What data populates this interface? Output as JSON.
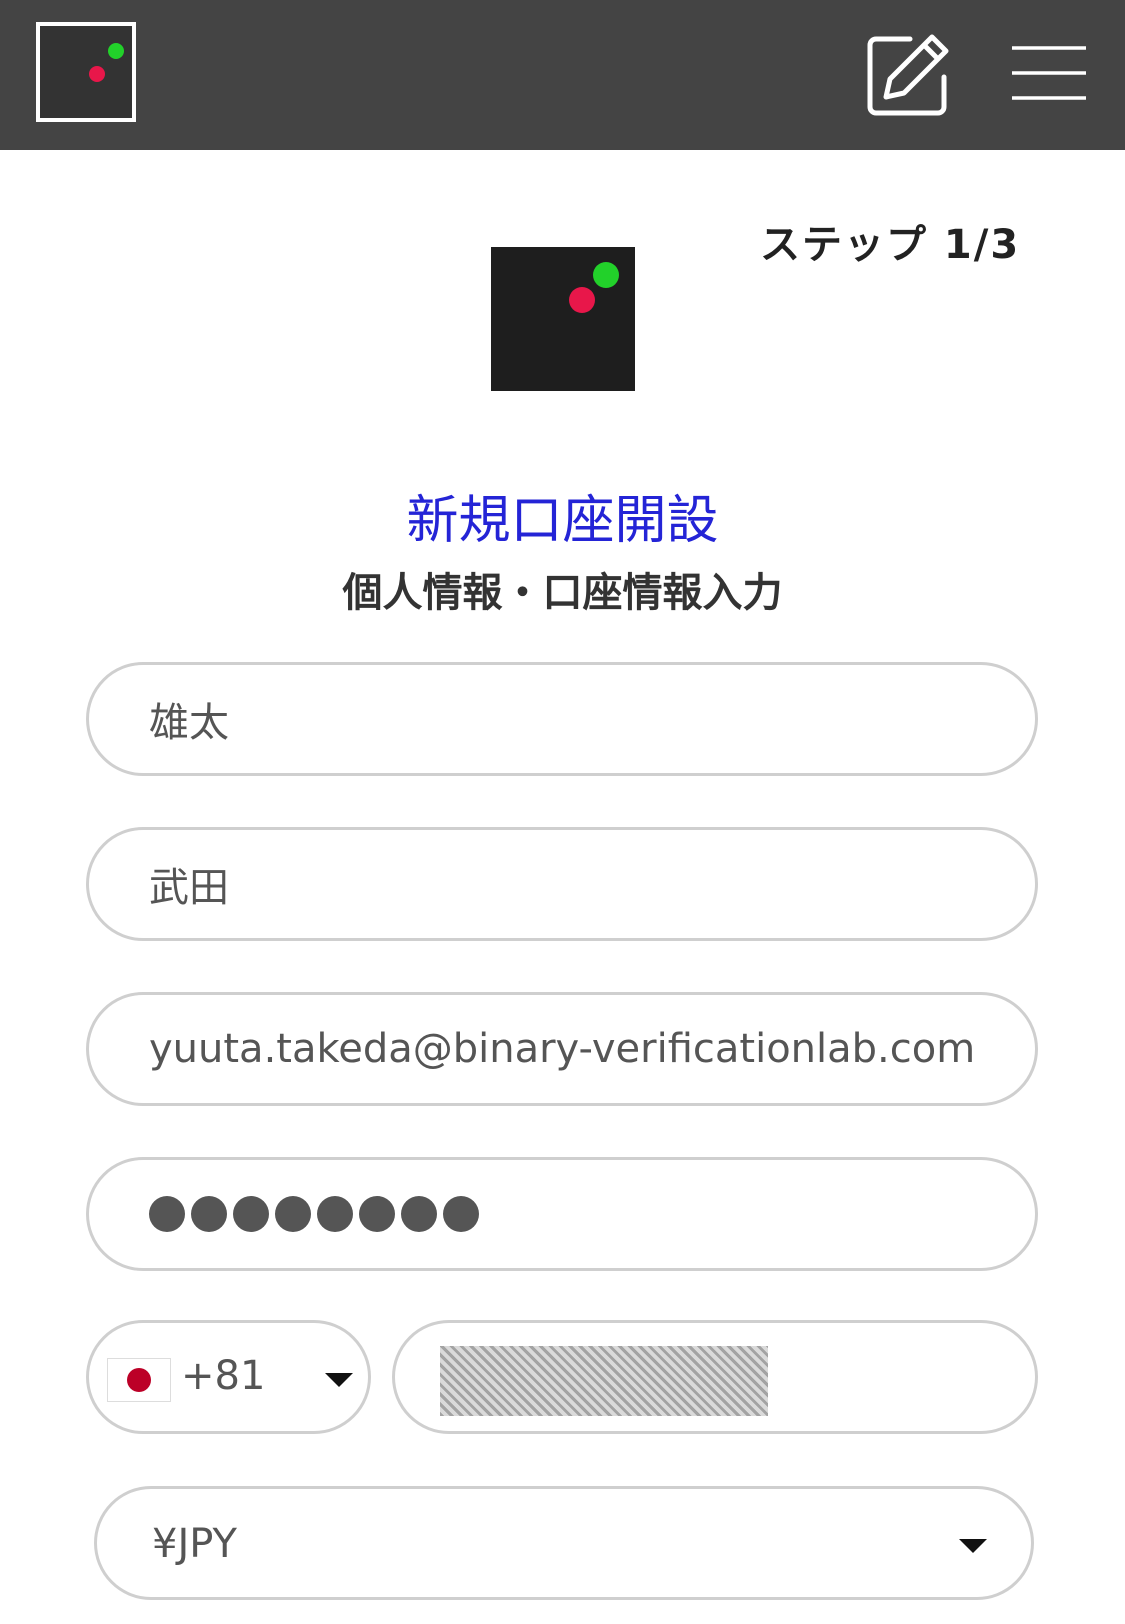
{
  "header": {
    "logo_icon": "brand-logo-icon",
    "edit_icon": "edit-icon",
    "menu_icon": "hamburger-menu-icon"
  },
  "step": "ステップ 1/3",
  "title": "新規口座開設",
  "subtitle": "個人情報・口座情報入力",
  "form": {
    "first_name": "雄太",
    "last_name": "武田",
    "email": "yuuta.takeda@binary-verificationlab.com",
    "password_masked": "●●●●●●●●",
    "country_flag": "japan-flag-icon",
    "country_code": "+81",
    "phone_redacted": true,
    "currency": "¥JPY"
  },
  "colors": {
    "header_bg": "#444444",
    "title_blue": "#2424d6",
    "dot_red": "#e8174a",
    "dot_green": "#22d12a"
  }
}
